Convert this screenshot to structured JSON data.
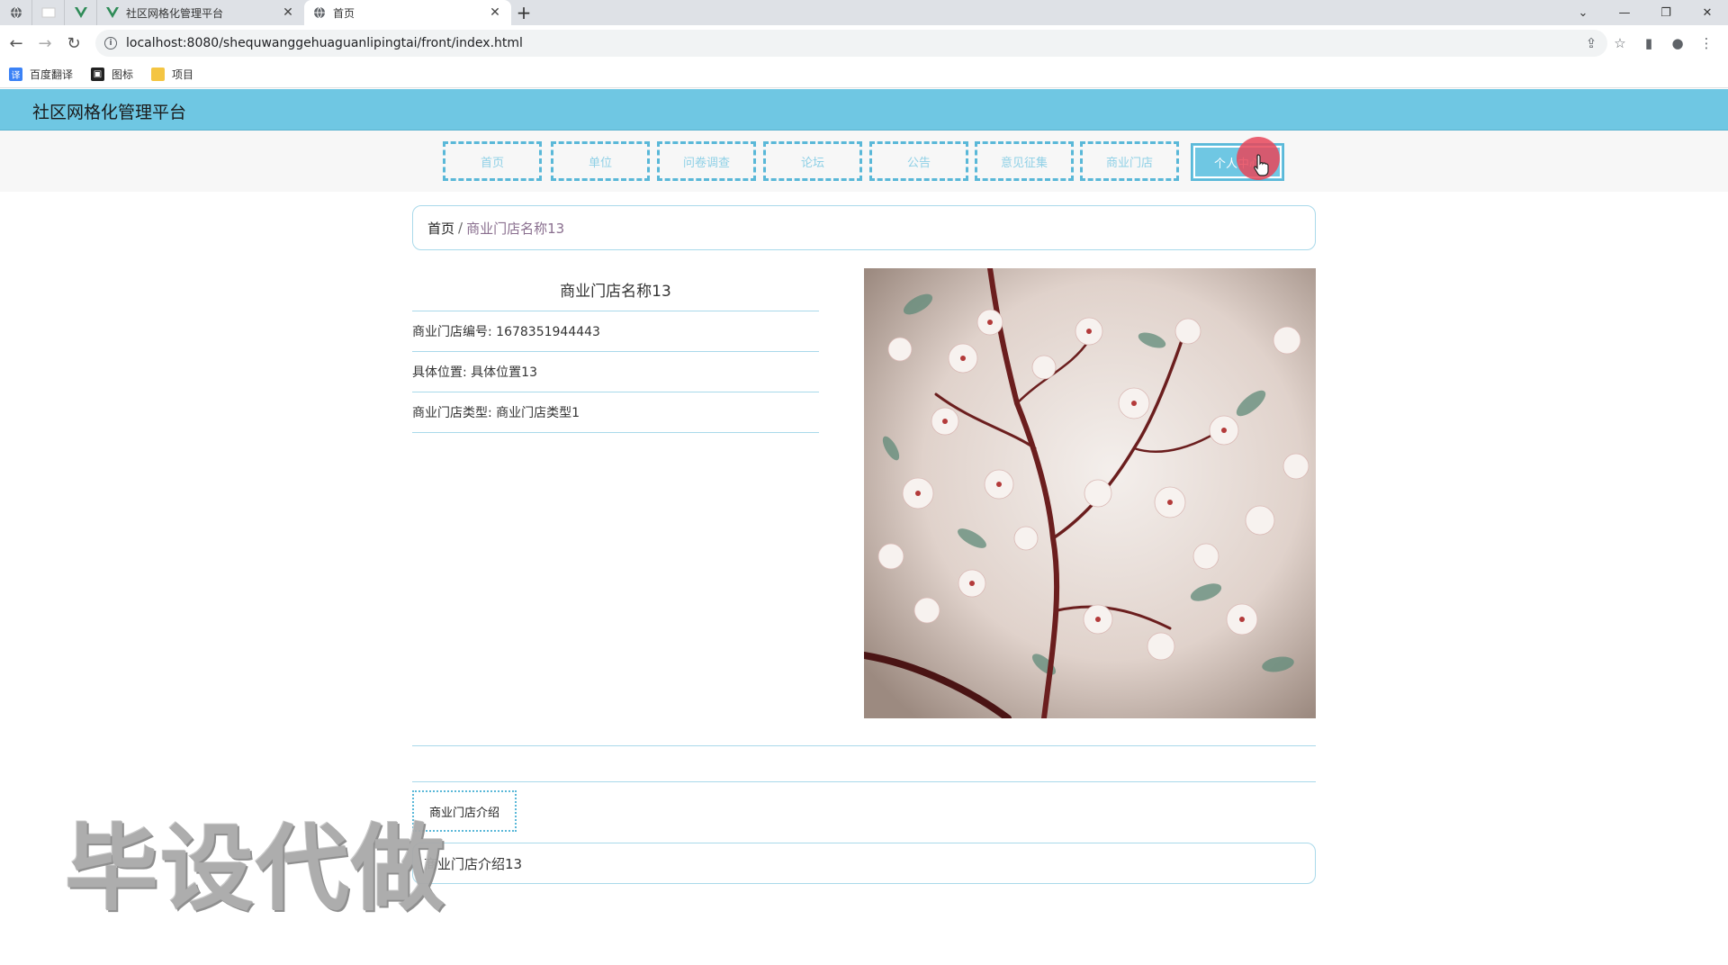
{
  "browser": {
    "tabs": [
      {
        "title": "社区网格化管理平台",
        "active": false
      },
      {
        "title": "首页",
        "active": true
      }
    ],
    "new_tab": "+",
    "url": "localhost:8080/shequwanggehuaguanlipingtai/front/index.html",
    "bookmarks": [
      {
        "label": "百度翻译",
        "icon": "translate-icon",
        "color": "#3b82f6"
      },
      {
        "label": "图标",
        "icon": "image-icon",
        "color": "#222222"
      },
      {
        "label": "项目",
        "icon": "folder-icon",
        "color": "#f4c542"
      }
    ]
  },
  "site": {
    "title": "社区网格化管理平台",
    "accent": "#6fc7e3"
  },
  "nav": {
    "items": [
      {
        "label": "首页",
        "active": false
      },
      {
        "label": "单位",
        "active": false
      },
      {
        "label": "问卷调查",
        "active": false
      },
      {
        "label": "论坛",
        "active": false
      },
      {
        "label": "公告",
        "active": false
      },
      {
        "label": "意见征集",
        "active": false
      },
      {
        "label": "商业门店",
        "active": false
      },
      {
        "label": "个人中心",
        "active": true
      }
    ]
  },
  "breadcrumb": {
    "home": "首页",
    "separator": "/",
    "current": "商业门店名称13"
  },
  "detail": {
    "title": "商业门店名称13",
    "rows": [
      {
        "label": "商业门店编号: 1678351944443"
      },
      {
        "label": "具体位置: 具体位置13"
      },
      {
        "label": "商业门店类型: 商业门店类型1"
      }
    ]
  },
  "intro": {
    "tab_label": "商业门店介绍",
    "content": "商业门店介绍13"
  },
  "watermark": "毕设代做"
}
